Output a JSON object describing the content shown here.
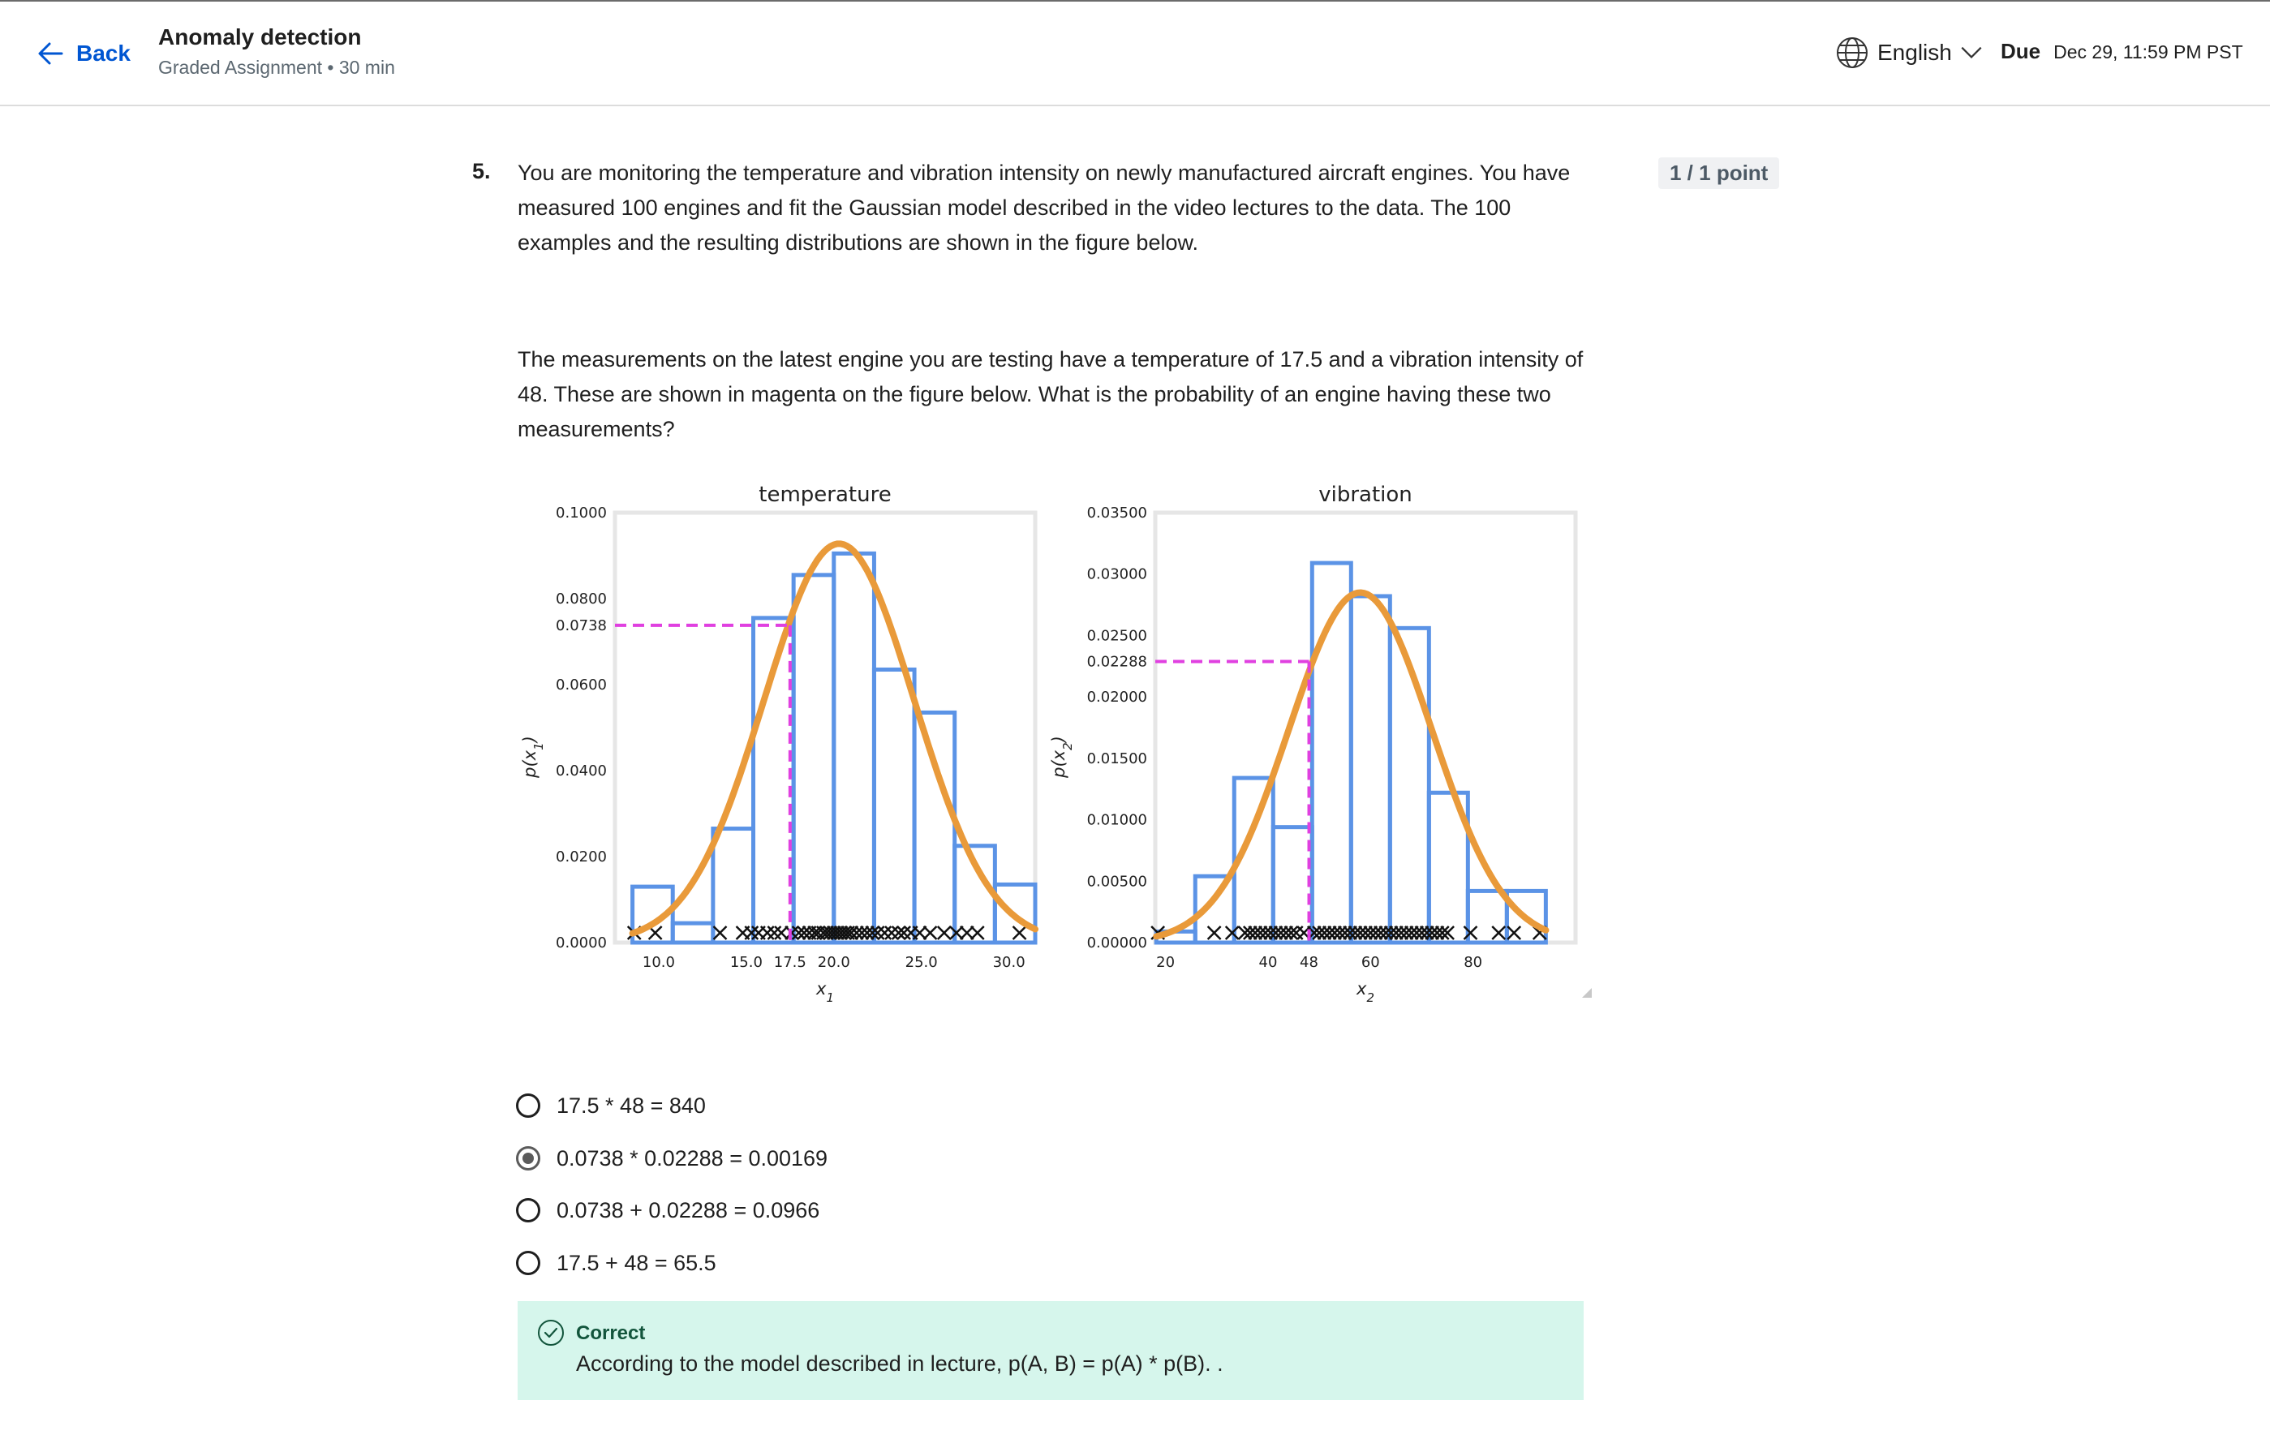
{
  "header": {
    "back_label": "Back",
    "title": "Anomaly detection",
    "subtitle": "Graded Assignment • 30 min",
    "language": "English",
    "due_label": "Due",
    "due_value": "Dec 29, 11:59 PM PST"
  },
  "question": {
    "number": "5.",
    "paragraph1": "You are monitoring the temperature and vibration intensity on newly manufactured aircraft engines. You have measured 100 engines and fit the Gaussian model described in the video lectures to the data. The 100 examples and the resulting distributions are shown in the figure below.",
    "paragraph2": "The measurements on the latest engine you are testing have a temperature of 17.5 and a vibration intensity of 48. These are shown in magenta on the figure below. What is the probability of an engine having these two measurements?",
    "points": "1 / 1 point"
  },
  "options": [
    {
      "label": "17.5 * 48 = 840",
      "selected": false
    },
    {
      "label": "0.0738 * 0.02288 = 0.00169",
      "selected": true
    },
    {
      "label": "0.0738 + 0.02288 = 0.0966",
      "selected": false
    },
    {
      "label": "17.5 + 48 = 65.5",
      "selected": false
    }
  ],
  "feedback": {
    "title": "Correct",
    "text": "According to the model described in lecture, p(A, B) = p(A) * p(B). ."
  },
  "colors": {
    "accent": "#0056d2",
    "histogram": "#5b93e6",
    "gaussian": "#e99a3a",
    "marker": "#e040e0",
    "feedback_bg": "#d6f6ec"
  },
  "chart_data": [
    {
      "type": "histogram",
      "title": "temperature",
      "xlabel": "x1",
      "ylabel": "p(x1)",
      "ylim": [
        0,
        0.1
      ],
      "xlim": [
        7.5,
        31.5
      ],
      "yticks": [
        "0.0000",
        "0.0200",
        "0.0400",
        "0.0600",
        "0.0738",
        "0.0800",
        "0.1000"
      ],
      "xticks": [
        "10.0",
        "15.0",
        "17.5",
        "20.0",
        "25.0",
        "30.0"
      ],
      "bins": [
        8.5,
        10.8,
        13.1,
        15.4,
        17.7,
        20.0,
        22.3,
        24.6,
        26.9,
        29.2,
        31.5
      ],
      "values": [
        0.013,
        0.0045,
        0.0265,
        0.0755,
        0.0855,
        0.0905,
        0.0635,
        0.0535,
        0.0225,
        0.0135
      ],
      "gaussian": {
        "mean": 20.3,
        "std": 4.3
      },
      "marker": {
        "x": 17.5,
        "y": 0.0738
      },
      "samples": [
        8.6,
        9.8,
        13.5,
        14.8,
        15.3,
        15.7,
        16.2,
        16.6,
        17.0,
        17.6,
        18.0,
        18.3,
        18.6,
        18.9,
        19.1,
        19.4,
        19.6,
        19.8,
        20.0,
        20.2,
        20.4,
        20.6,
        20.8,
        21.0,
        21.3,
        21.6,
        21.9,
        22.2,
        22.5,
        22.9,
        23.3,
        23.7,
        24.0,
        24.4,
        24.9,
        25.5,
        26.3,
        27.0,
        27.6,
        28.2,
        30.6
      ]
    },
    {
      "type": "histogram",
      "title": "vibration",
      "xlabel": "x2",
      "ylabel": "p(x2)",
      "ylim": [
        0,
        0.035
      ],
      "xlim": [
        18,
        100
      ],
      "yticks": [
        "0.00000",
        "0.00500",
        "0.01000",
        "0.01500",
        "0.02000",
        "0.02288",
        "0.02500",
        "0.03000",
        "0.03500"
      ],
      "xticks": [
        "20",
        "40",
        "48",
        "60",
        "80"
      ],
      "bins": [
        18.2,
        25.8,
        33.4,
        41.0,
        48.6,
        56.2,
        63.8,
        71.4,
        79.0,
        86.6,
        94.2
      ],
      "values": [
        0.0009,
        0.0054,
        0.0134,
        0.0094,
        0.0309,
        0.0282,
        0.0256,
        0.0122,
        0.0042,
        0.0042
      ],
      "gaussian": {
        "mean": 58.0,
        "std": 14.0
      },
      "marker": {
        "x": 48,
        "y": 0.02288
      },
      "samples": [
        18.5,
        29.5,
        33.0,
        35.5,
        36.5,
        37.5,
        38.5,
        39.5,
        40.5,
        41.5,
        42.5,
        43.5,
        44.5,
        45.5,
        47.0,
        49.0,
        50.0,
        51.0,
        52.0,
        53.0,
        54.0,
        55.0,
        56.0,
        57.0,
        58.0,
        59.0,
        60.0,
        61.0,
        62.0,
        63.0,
        64.0,
        65.0,
        66.0,
        67.0,
        68.0,
        69.0,
        70.0,
        71.0,
        72.0,
        73.0,
        74.0,
        75.0,
        79.5,
        85.0,
        88.0,
        93.0
      ]
    }
  ]
}
